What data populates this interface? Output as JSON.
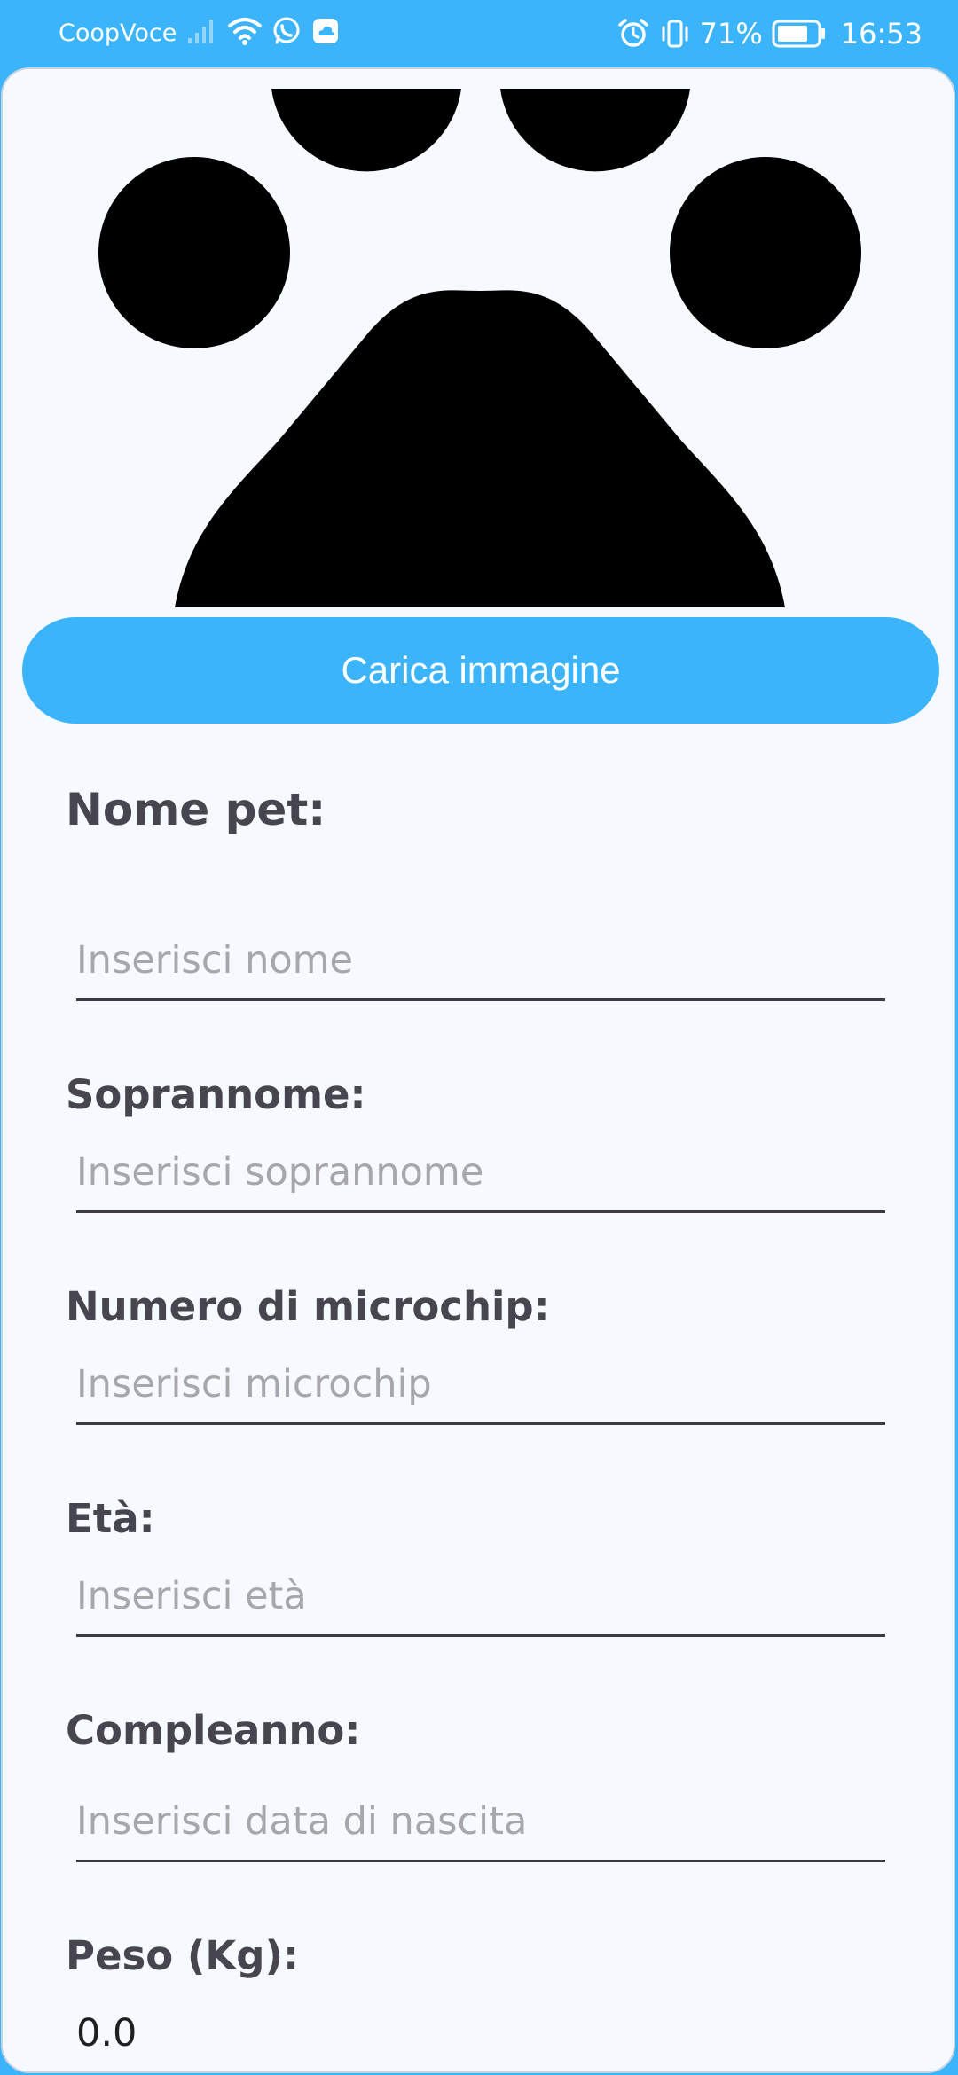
{
  "status_bar": {
    "carrier": "CoopVoce",
    "battery": "71%",
    "time": "16:53",
    "icons": [
      "signal-icon",
      "wifi-icon",
      "whatsapp-icon",
      "cloud-icon",
      "alarm-icon",
      "vibrate-icon",
      "battery-icon"
    ]
  },
  "header": {
    "image_icon": "paw-icon",
    "upload_label": "Carica immagine"
  },
  "form": {
    "fields": [
      {
        "label": "Nome pet:",
        "placeholder": "Inserisci nome",
        "value": ""
      },
      {
        "label": "Soprannome:",
        "placeholder": "Inserisci soprannome",
        "value": ""
      },
      {
        "label": "Numero di microchip:",
        "placeholder": "Inserisci microchip",
        "value": ""
      },
      {
        "label": "Età:",
        "placeholder": "Inserisci età",
        "value": ""
      },
      {
        "label": "Compleanno:",
        "placeholder": "Inserisci data di nascita",
        "value": ""
      },
      {
        "label": "Peso (Kg):",
        "placeholder": "",
        "value": "0.0"
      }
    ]
  },
  "colors": {
    "accent": "#3cb4fb",
    "background": "#f6f9ff",
    "label": "#47454f",
    "placeholder": "#a6a6ab",
    "underline": "#3c3a42"
  }
}
